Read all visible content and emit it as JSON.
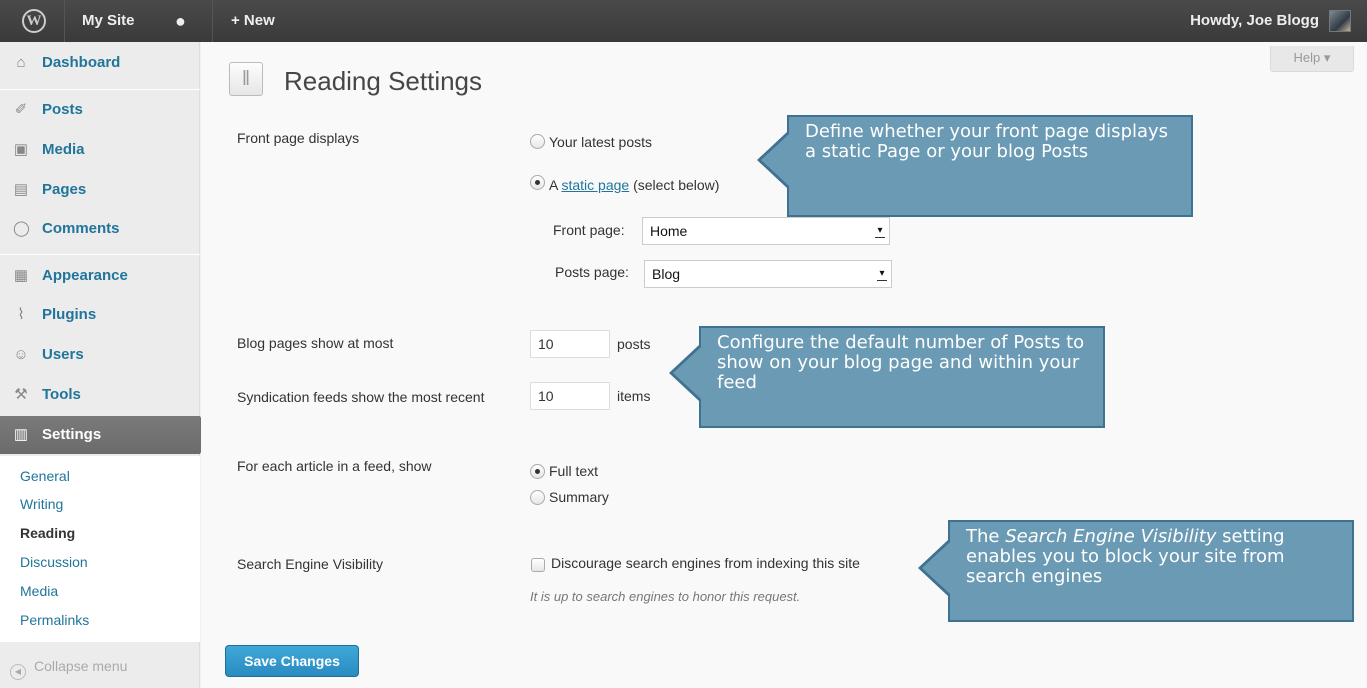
{
  "adminbar": {
    "site_name": "My Site",
    "new_label": "+ New",
    "greeting": "Howdy, Joe Blogg"
  },
  "sidebar": {
    "items": [
      {
        "label": "Dashboard",
        "icon": "home-icon"
      },
      {
        "label": "Posts",
        "icon": "pushpin-icon"
      },
      {
        "label": "Media",
        "icon": "media-icon"
      },
      {
        "label": "Pages",
        "icon": "pages-icon"
      },
      {
        "label": "Comments",
        "icon": "comment-icon"
      },
      {
        "label": "Appearance",
        "icon": "appearance-icon"
      },
      {
        "label": "Plugins",
        "icon": "plugin-icon"
      },
      {
        "label": "Users",
        "icon": "users-icon"
      },
      {
        "label": "Tools",
        "icon": "tools-icon"
      },
      {
        "label": "Settings",
        "icon": "settings-icon"
      }
    ],
    "submenu": [
      "General",
      "Writing",
      "Reading",
      "Discussion",
      "Media",
      "Permalinks"
    ],
    "collapse_label": "Collapse menu"
  },
  "help_label": "Help",
  "page_title": "Reading Settings",
  "settings": {
    "front_page": {
      "label": "Front page displays",
      "option_latest": "Your latest posts",
      "option_static_prefix": "A ",
      "option_static_link": "static page",
      "option_static_suffix": " (select below)",
      "selected": "static",
      "front_page_label": "Front page:",
      "front_page_value": "Home",
      "posts_page_label": "Posts page:",
      "posts_page_value": "Blog"
    },
    "blog_pages": {
      "label": "Blog pages show at most",
      "value": "10",
      "unit": "posts"
    },
    "syndication": {
      "label": "Syndication feeds show the most recent",
      "value": "10",
      "unit": "items"
    },
    "feed_article": {
      "label": "For each article in a feed, show",
      "option_full": "Full text",
      "option_summary": "Summary",
      "selected": "full"
    },
    "search_engine": {
      "label": "Search Engine Visibility",
      "checkbox_label": "Discourage search engines from indexing this site",
      "checked": false,
      "description": "It is up to search engines to honor this request."
    }
  },
  "save_label": "Save Changes",
  "callouts": {
    "front_page": "Define whether your front page displays a static Page or your blog Posts",
    "posts_count": "Configure the default number of Posts to show on your blog page and within your feed",
    "search_emph": "Search Engine Visibility",
    "search_pre": "The ",
    "search_post": " setting enables you to block your site from search engines"
  },
  "colors": {
    "adminbar": "#464646",
    "link": "#21759b",
    "callout_fill": "#6a9ab4",
    "callout_border": "#3f7290",
    "primary_button": "#2a8bc0"
  }
}
